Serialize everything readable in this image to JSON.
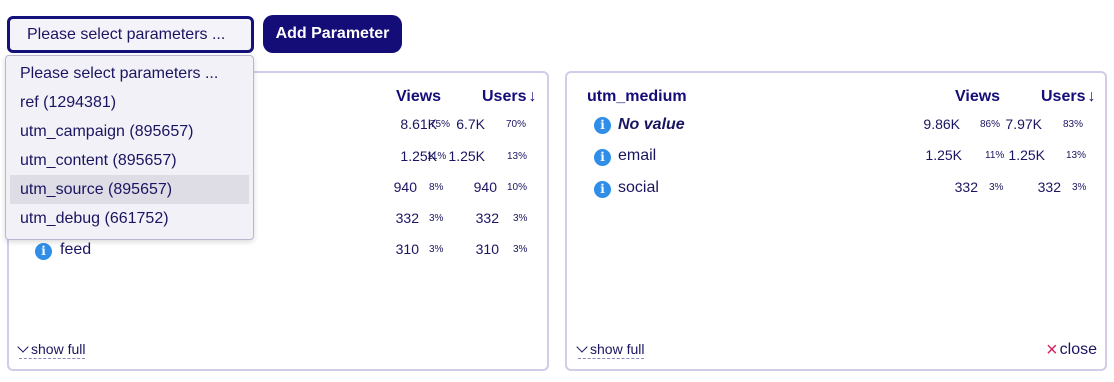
{
  "toolbar": {
    "select_value": "Please select parameters ...",
    "add_button": "Add Parameter"
  },
  "dropdown": {
    "options": [
      "Please select parameters ...",
      "ref (1294381)",
      "utm_campaign (895657)",
      "utm_content (895657)",
      "utm_source (895657)",
      "utm_debug (661752)"
    ],
    "highlighted_index": 4
  },
  "left_card": {
    "views_label": "Views",
    "users_label": "Users",
    "sort_indicator": "↓",
    "rows": [
      {
        "label": "",
        "views": "8.61K",
        "views_pct": "75%",
        "users": "6.7K",
        "users_pct": "70%"
      },
      {
        "label": "",
        "views": "1.25K",
        "views_pct": "11%",
        "users": "1.25K",
        "users_pct": "13%"
      },
      {
        "label": "",
        "views": "940",
        "views_pct": "8%",
        "users": "940",
        "users_pct": "10%"
      },
      {
        "label": "",
        "views": "332",
        "views_pct": "3%",
        "users": "332",
        "users_pct": "3%"
      },
      {
        "label": "feed",
        "views": "310",
        "views_pct": "3%",
        "users": "310",
        "users_pct": "3%"
      }
    ],
    "show_full": "show full"
  },
  "right_card": {
    "title": "utm_medium",
    "views_label": "Views",
    "users_label": "Users",
    "sort_indicator": "↓",
    "rows": [
      {
        "label": "No value",
        "views": "9.86K",
        "views_pct": "86%",
        "users": "7.97K",
        "users_pct": "83%"
      },
      {
        "label": "email",
        "views": "1.25K",
        "views_pct": "11%",
        "users": "1.25K",
        "users_pct": "13%"
      },
      {
        "label": "social",
        "views": "332",
        "views_pct": "3%",
        "users": "332",
        "users_pct": "3%"
      }
    ],
    "show_full": "show full",
    "close": "close"
  },
  "colors": {
    "primary": "#140d78",
    "info_icon": "#2f8ee8",
    "close_icon": "#d6265e",
    "card_border": "#cfcde8"
  }
}
